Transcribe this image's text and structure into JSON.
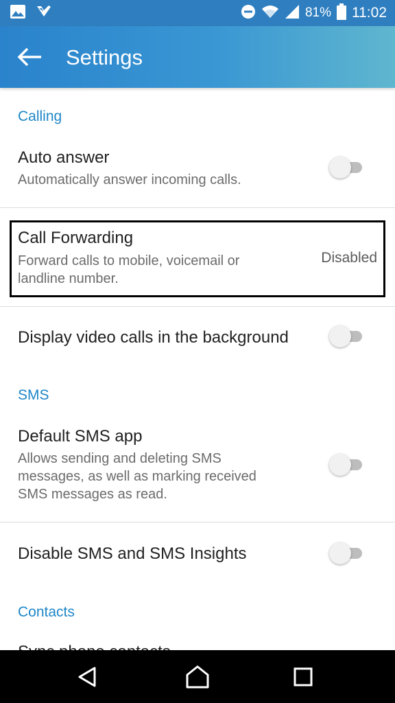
{
  "status_bar": {
    "icons_left": [
      "image-icon",
      "checkmark-app-icon"
    ],
    "icons_right": [
      "do-not-disturb-icon",
      "wifi-icon",
      "signal-icon",
      "battery-icon"
    ],
    "battery_percent": "81%",
    "time": "11:02"
  },
  "app_bar": {
    "back_icon": "arrow-left-icon",
    "title": "Settings"
  },
  "sections": {
    "calling": "Calling",
    "sms": "SMS",
    "contacts": "Contacts"
  },
  "items": {
    "auto_answer": {
      "title": "Auto answer",
      "subtitle": "Automatically answer incoming calls.",
      "enabled": false
    },
    "call_forwarding": {
      "title": "Call Forwarding",
      "subtitle_line1": "Forward calls to mobile, voicemail or",
      "subtitle_line2": "landline number.",
      "value": "Disabled"
    },
    "video_background": {
      "title": "Display video calls in the background",
      "enabled": false
    },
    "default_sms": {
      "title": "Default SMS app",
      "subtitle_line1": "Allows sending and deleting SMS",
      "subtitle_line2": "messages, as well as marking received",
      "subtitle_line3": "SMS messages as read.",
      "enabled": false
    },
    "disable_sms": {
      "title": "Disable SMS and SMS Insights",
      "enabled": false
    },
    "sync_contacts": {
      "title": "Sync phone contacts"
    }
  },
  "nav_bar": {
    "buttons": [
      "back-triangle-icon",
      "home-icon",
      "recents-square-icon"
    ]
  },
  "colors": {
    "accent": "#1e86c8",
    "app_bar_start": "#2a83cc",
    "app_bar_end": "#5fb6cf",
    "toggle_off_track": "#bdbdbd"
  }
}
